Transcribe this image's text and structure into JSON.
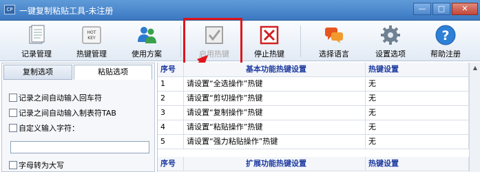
{
  "window": {
    "title": "一键复制粘贴工具-未注册",
    "icon": "CP",
    "min": "—",
    "max": "□",
    "close": "✕"
  },
  "toolbar": {
    "buttons": [
      {
        "id": "records",
        "label": "记录管理",
        "icon": "records-icon"
      },
      {
        "id": "hotkey",
        "label": "热键管理",
        "icon": "hotkey-icon",
        "icon_text": "HOT KEY"
      },
      {
        "id": "plan",
        "label": "使用方案",
        "icon": "users-icon"
      },
      {
        "id": "enable",
        "label": "启用热键",
        "icon": "checkbox-icon",
        "disabled": true
      },
      {
        "id": "stop",
        "label": "停止热键",
        "icon": "stop-x-icon"
      },
      {
        "id": "lang",
        "label": "选择语言",
        "icon": "chat-icon"
      },
      {
        "id": "settings",
        "label": "设置选项",
        "icon": "gear-icon"
      },
      {
        "id": "help",
        "label": "帮助注册",
        "icon": "help-icon",
        "icon_text": "?"
      }
    ]
  },
  "left_panel": {
    "tabs": [
      "复制选项",
      "粘贴选项"
    ],
    "options": [
      "记录之间自动输入回车符",
      "记录之间自动输入制表符TAB",
      "自定义输入字符：",
      "字母转为大写"
    ],
    "custom_value": ""
  },
  "grid": {
    "header1": [
      "序号",
      "基本功能热键设置",
      "热键设置"
    ],
    "rows": [
      [
        "1",
        "请设置“全选操作”热键",
        "无"
      ],
      [
        "2",
        "请设置“剪切操作”热键",
        "无"
      ],
      [
        "3",
        "请设置“复制操作”热键",
        "无"
      ],
      [
        "4",
        "请设置“粘贴操作”热键",
        "无"
      ],
      [
        "5",
        "请设置“强力粘贴操作”热键",
        "无"
      ]
    ],
    "header2": [
      "序号",
      "扩展功能热键设置",
      "热键设置"
    ]
  },
  "colors": {
    "accent_red": "#e0141a",
    "header_blue": "#1f3ca0"
  }
}
